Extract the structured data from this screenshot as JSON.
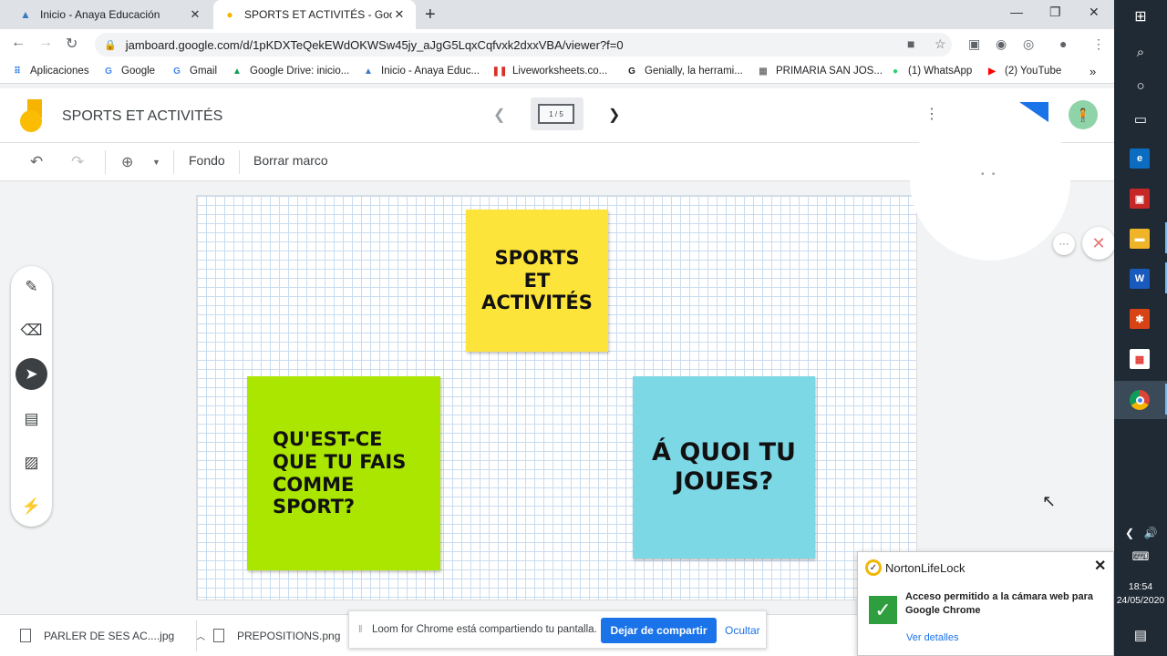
{
  "browser": {
    "tabs": [
      {
        "title": "Inicio - Anaya Educación",
        "favicon": "anaya-icon",
        "active": false
      },
      {
        "title": "SPORTS ET ACTIVITÉS - Google J",
        "favicon": "jamboard-icon",
        "active": true
      }
    ],
    "url": "jamboard.google.com/d/1pKDXTeQekEWdOKWSw45jy_aJgG5LqxCqfvxk2dxxVBA/viewer?f=0",
    "bookmarks": [
      {
        "label": "Aplicaciones",
        "icon": "apps-grid-icon"
      },
      {
        "label": "Google",
        "icon": "google-icon"
      },
      {
        "label": "Gmail",
        "icon": "google-icon"
      },
      {
        "label": "Google Drive: inicio...",
        "icon": "drive-icon"
      },
      {
        "label": "Inicio - Anaya Educ...",
        "icon": "anaya-icon"
      },
      {
        "label": "Liveworksheets.co...",
        "icon": "liveworksheets-icon"
      },
      {
        "label": "Genially, la herrami...",
        "icon": "genially-icon"
      },
      {
        "label": "PRIMARIA SAN JOS...",
        "icon": "school-icon"
      },
      {
        "label": "(1) WhatsApp",
        "icon": "whatsapp-icon"
      },
      {
        "label": "(2) YouTube",
        "icon": "youtube-icon"
      }
    ]
  },
  "jamboard": {
    "title": "SPORTS ET ACTIVITÉS",
    "frame_indicator": "1 / 5",
    "toolbar": {
      "background_label": "Fondo",
      "clear_label": "Borrar marco"
    },
    "notes": [
      {
        "text": "SPORTS\nET\nACTIVITÉS",
        "color": "#fce43a"
      },
      {
        "text": "QU'EST-CE\nQUE TU FAIS\nCOMME\nSPORT?",
        "color": "#abe600"
      },
      {
        "text": "Á QUOI TU\nJOUES?",
        "color": "#7dd8e6"
      }
    ],
    "side_tools": [
      "pen-icon",
      "eraser-icon",
      "select-icon",
      "sticky-note-icon",
      "image-icon",
      "laser-icon"
    ]
  },
  "downloads": [
    {
      "name": "PARLER DE SES AC....jpg"
    },
    {
      "name": "PREPOSITIONS.png"
    }
  ],
  "loom": {
    "message": "Loom for Chrome está compartiendo tu pantalla.",
    "stop_label": "Dejar de compartir",
    "hide_label": "Ocultar"
  },
  "norton": {
    "brand": "NortonLifeLock",
    "message": "Acceso permitido a la cámara web para Google Chrome",
    "link": "Ver detalles"
  },
  "taskbar": {
    "time": "18:54",
    "date": "24/05/2020"
  }
}
